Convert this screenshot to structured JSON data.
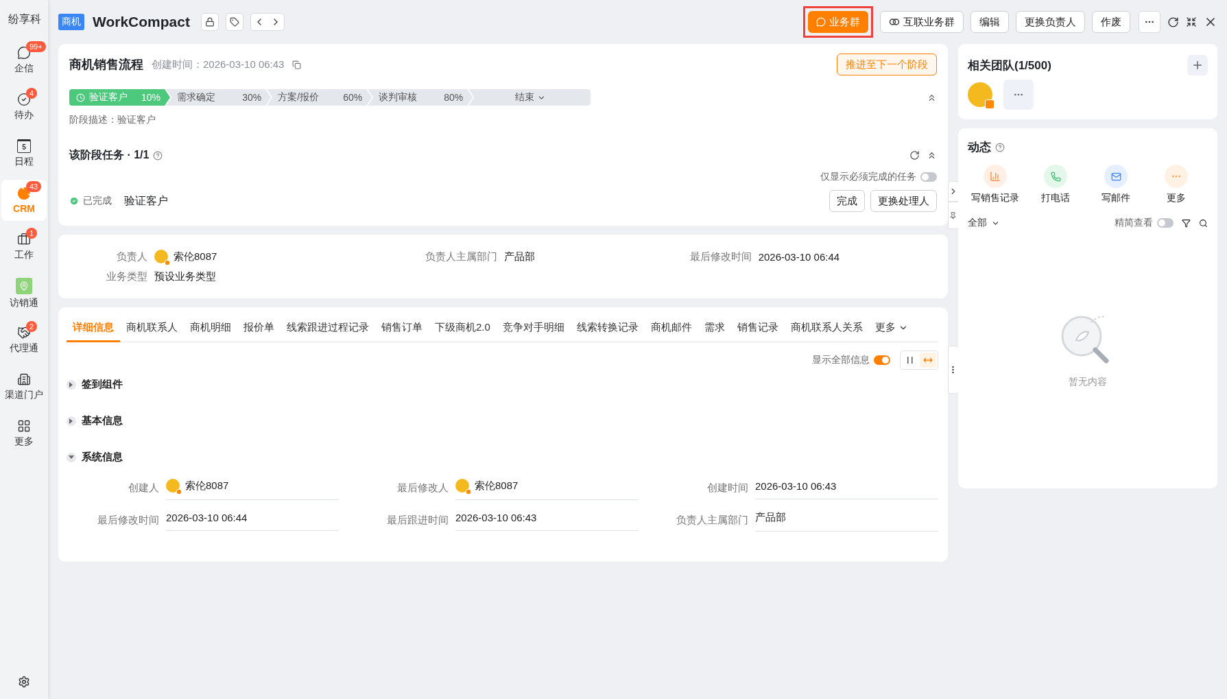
{
  "sidebar": {
    "company": "纷享科",
    "items": [
      {
        "kind": "chat",
        "label": "企信",
        "badge": "99+",
        "selected": false
      },
      {
        "kind": "check",
        "label": "待办",
        "badge": "4",
        "selected": false
      },
      {
        "kind": "calendar",
        "label": "日程",
        "icon_text": "5",
        "selected": false
      },
      {
        "kind": "pie",
        "label": "CRM",
        "badge": "43",
        "selected": true
      },
      {
        "kind": "briefcase",
        "label": "工作",
        "badge": "1",
        "selected": false
      },
      {
        "kind": "tile",
        "label": "访销通",
        "selected": false
      },
      {
        "kind": "handshake",
        "label": "代理通",
        "badge": "2",
        "selected": false
      },
      {
        "kind": "building",
        "label": "渠道门户",
        "selected": false
      },
      {
        "kind": "grid",
        "label": "更多",
        "selected": false
      }
    ]
  },
  "header": {
    "tag": "商机",
    "title": "WorkCompact",
    "buttons": [
      {
        "kind": "primary",
        "label": "业务群",
        "highlighted": true
      },
      {
        "kind": "link",
        "label": "互联业务群",
        "highlighted": false
      },
      {
        "kind": "plain",
        "label": "编辑",
        "highlighted": false
      },
      {
        "kind": "plain",
        "label": "更换负责人",
        "highlighted": false
      },
      {
        "kind": "plain",
        "label": "作废",
        "highlighted": false
      }
    ]
  },
  "stage_card": {
    "title": "商机销售流程",
    "created": "创建时间：2026-03-10 06:43",
    "advance_button": "推进至下一个阶段",
    "stages": [
      {
        "kind": "step",
        "name": "验证客户",
        "percent": "10%",
        "selected": true
      },
      {
        "kind": "step",
        "name": "需求确定",
        "percent": "30%",
        "selected": false
      },
      {
        "kind": "step",
        "name": "方案/报价",
        "percent": "60%",
        "selected": false
      },
      {
        "kind": "step",
        "name": "谈判审核",
        "percent": "80%",
        "selected": false
      },
      {
        "kind": "end",
        "name": "结束",
        "selected": false
      }
    ],
    "description": "阶段描述：验证客户",
    "tasks_title": "该阶段任务 · 1/1",
    "required_toggle": {
      "label": "仅显示必须完成的任务",
      "on": false
    },
    "tasks": [
      {
        "status": "已完成",
        "name": "验证客户",
        "done": true
      }
    ],
    "task_buttons": [
      "完成",
      "更换处理人"
    ]
  },
  "summary": {
    "fields": [
      {
        "label": "负责人",
        "value": "索伦8087",
        "avatar": true
      },
      {
        "label": "负责人主属部门",
        "value": "产品部",
        "avatar": false
      },
      {
        "label": "最后修改时间",
        "value": "2026-03-10 06:44",
        "avatar": false
      },
      {
        "label": "业务类型",
        "value": "预设业务类型",
        "avatar": false
      }
    ]
  },
  "detail": {
    "tabs": [
      {
        "label": "详细信息",
        "selected": true
      },
      {
        "label": "商机联系人",
        "selected": false
      },
      {
        "label": "商机明细",
        "selected": false
      },
      {
        "label": "报价单",
        "selected": false
      },
      {
        "label": "线索跟进过程记录",
        "selected": false
      },
      {
        "label": "销售订单",
        "selected": false
      },
      {
        "label": "下级商机2.0",
        "selected": false
      },
      {
        "label": "竞争对手明细",
        "selected": false
      },
      {
        "label": "线索转换记录",
        "selected": false
      },
      {
        "label": "商机邮件",
        "selected": false
      },
      {
        "label": "需求",
        "selected": false
      },
      {
        "label": "销售记录",
        "selected": false
      },
      {
        "label": "商机联系人关系",
        "selected": false
      }
    ],
    "more_tab": "更多",
    "show_all_toggle": {
      "label": "显示全部信息",
      "on": true
    },
    "layout_modes": [
      {
        "kind": "columns",
        "selected": false
      },
      {
        "kind": "wide",
        "selected": true
      }
    ],
    "sections": [
      {
        "title": "签到组件",
        "expanded": false
      },
      {
        "title": "基本信息",
        "expanded": false
      },
      {
        "title": "系统信息",
        "expanded": true,
        "fields": [
          {
            "label": "创建人",
            "value": "索伦8087",
            "avatar": true
          },
          {
            "label": "最后修改人",
            "value": "索伦8087",
            "avatar": true
          },
          {
            "label": "创建时间",
            "value": "2026-03-10 06:43",
            "avatar": false
          },
          {
            "label": "最后修改时间",
            "value": "2026-03-10 06:44",
            "avatar": false
          },
          {
            "label": "最后跟进时间",
            "value": "2026-03-10 06:43",
            "avatar": false
          },
          {
            "label": "负责人主属部门",
            "value": "产品部",
            "avatar": false
          }
        ]
      }
    ]
  },
  "team": {
    "title": "相关团队(1/500)"
  },
  "activity": {
    "title": "动态",
    "actions": [
      {
        "kind": "chart",
        "label": "写销售记录",
        "color": "#ff8a3d"
      },
      {
        "kind": "phone",
        "label": "打电话",
        "color": "#30c26a"
      },
      {
        "kind": "mail",
        "label": "写邮件",
        "color": "#3a86f5"
      },
      {
        "kind": "more",
        "label": "更多",
        "color": "#ff9a3d"
      }
    ],
    "filter": "全部",
    "compact_toggle": {
      "label": "精简查看",
      "on": false
    },
    "empty": "暂无内容"
  }
}
